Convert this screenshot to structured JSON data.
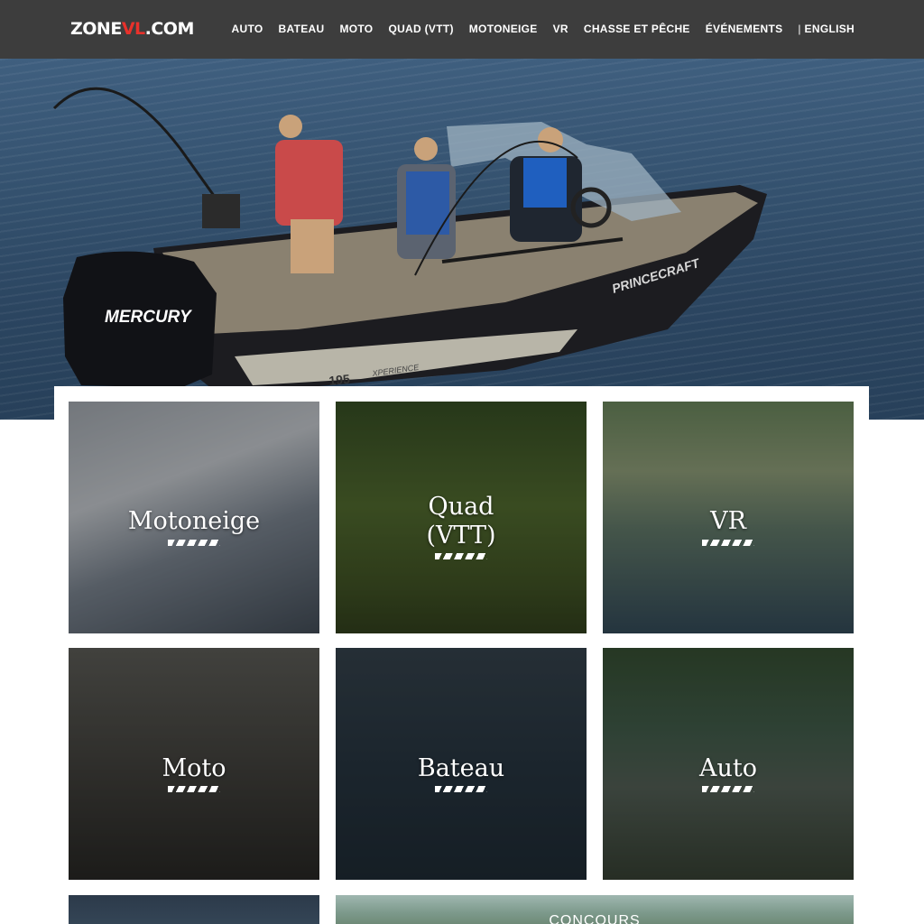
{
  "header": {
    "logo_main": "ZONE",
    "logo_accent": "VL",
    "logo_suffix": ".COM",
    "nav": [
      "AUTO",
      "BATEAU",
      "MOTO",
      "QUAD (VTT)",
      "MOTONEIGE",
      "VR",
      "CHASSE ET PÊCHE",
      "ÉVÉNEMENTS"
    ],
    "separator": "|",
    "language": "ENGLISH"
  },
  "hero": {
    "motor_brand": "MERCURY",
    "boat_brand": "PRINCECRAFT",
    "boat_model": "195",
    "boat_series": "XPERIENCE"
  },
  "tiles": [
    {
      "line1": "Motoneige",
      "line2": ""
    },
    {
      "line1": "Quad",
      "line2": "(VTT)"
    },
    {
      "line1": "VR",
      "line2": ""
    },
    {
      "line1": "Moto",
      "line2": ""
    },
    {
      "line1": "Bateau",
      "line2": ""
    },
    {
      "line1": "Auto",
      "line2": ""
    }
  ],
  "bottom": {
    "contest_label": "CONCOURS"
  },
  "colors": {
    "header_bg": "#3d3d3d",
    "logo_accent": "#e8312b",
    "water": "#33506d"
  }
}
